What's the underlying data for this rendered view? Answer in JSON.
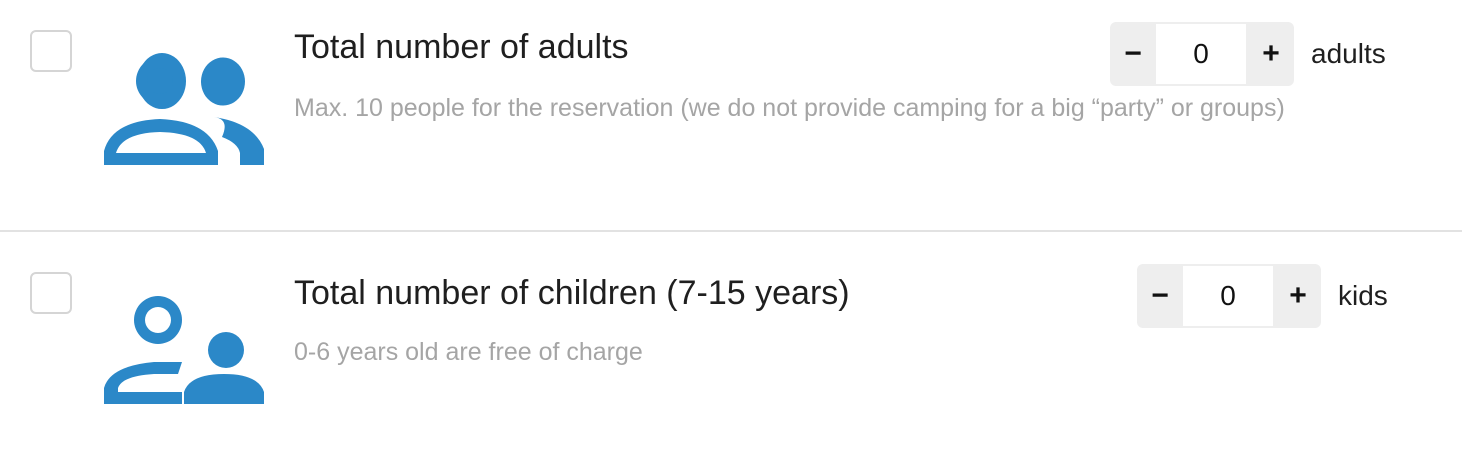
{
  "rows": [
    {
      "title": "Total number of adults",
      "subtitle": "Max. 10 people for the reservation (we do not provide camping for a big “party” or groups)",
      "minus": "−",
      "value": "0",
      "plus": "+",
      "unit": "adults",
      "icon": "adults-icon"
    },
    {
      "title": "Total number of children (7-15 years)",
      "subtitle": "0-6 years old are free of charge",
      "minus": "−",
      "value": "0",
      "plus": "+",
      "unit": "kids",
      "icon": "child-icon"
    }
  ],
  "colors": {
    "icon": "#2b88c8",
    "title": "#1f1f1f",
    "subtitle": "#a5a5a5",
    "stepper_bg": "#eeeeee",
    "divider": "#e2e2e2"
  }
}
